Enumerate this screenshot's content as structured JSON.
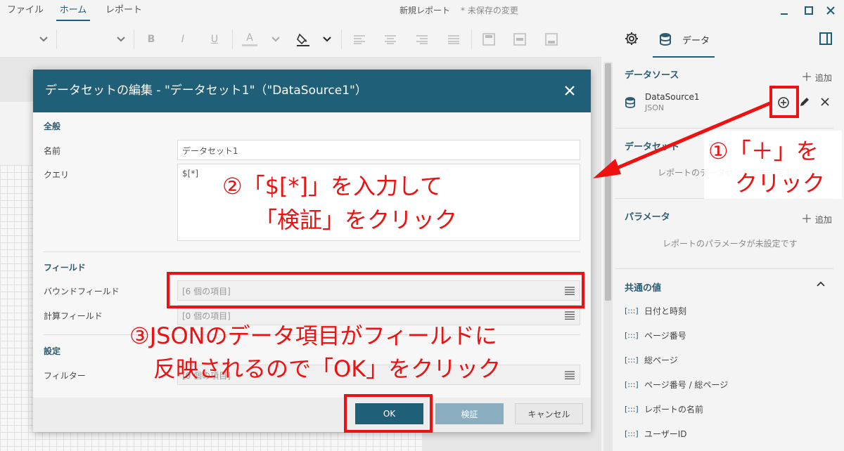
{
  "menu": {
    "file": "ファイル",
    "home": "ホーム",
    "report": "レポート"
  },
  "title": {
    "name": "新規レポート",
    "status": "* 未保存の変更"
  },
  "toolbar": {
    "bold": "B",
    "italic": "I",
    "underline": "U",
    "font_color": "A"
  },
  "right_panel": {
    "data_tab": "データ",
    "datasource": {
      "title": "データソース",
      "add": "追加",
      "item_name": "DataSource1",
      "item_type": "JSON"
    },
    "dataset": {
      "title": "データセット",
      "empty": "レポートのデータセットが未設定です"
    },
    "parameters": {
      "title": "パラメータ",
      "add": "追加",
      "empty": "レポートのパラメータが未設定です"
    },
    "common_values": {
      "title": "共通の値",
      "items": [
        "日付と時刻",
        "ページ番号",
        "総ページ",
        "ページ番号 / 総ページ",
        "レポートの名前",
        "ユーザーID"
      ]
    }
  },
  "dialog": {
    "title": "データセットの編集 - \"データセット1\"（\"DataSource1\"）",
    "general": "全般",
    "name_label": "名前",
    "name_value": "データセット1",
    "query_label": "クエリ",
    "query_value": "$[*]",
    "fields": "フィールド",
    "bound_label": "バウンドフィールド",
    "bound_value": "[6 個の項目]",
    "calc_label": "計算フィールド",
    "calc_value": "[0 個の項目]",
    "settings": "設定",
    "filter_label": "フィルター",
    "filter_value": "[0 個の項目]",
    "ok": "OK",
    "validate": "検証",
    "cancel": "キャンセル"
  },
  "annotations": {
    "step1_line1": "①「＋」を",
    "step1_line2": "クリック",
    "step2_line1": "②「$[*]」を入力して",
    "step2_line2": "「検証」をクリック",
    "step3_line1": "③JSONのデータ項目がフィールドに",
    "step3_line2": "反映されるので「OK」をクリック"
  },
  "colors": {
    "accent": "#205f78",
    "annotation": "#ee1111",
    "ok_button": "#205f78",
    "validate_button": "#8aaebf"
  },
  "icons": [
    "minimize-icon",
    "maximize-icon",
    "close-icon",
    "gear-icon",
    "database-icon",
    "panel-toggle-icon",
    "add-circle-icon",
    "edit-icon",
    "delete-icon",
    "collapse-icon",
    "hamburger-icon",
    "placeholder-icon"
  ]
}
